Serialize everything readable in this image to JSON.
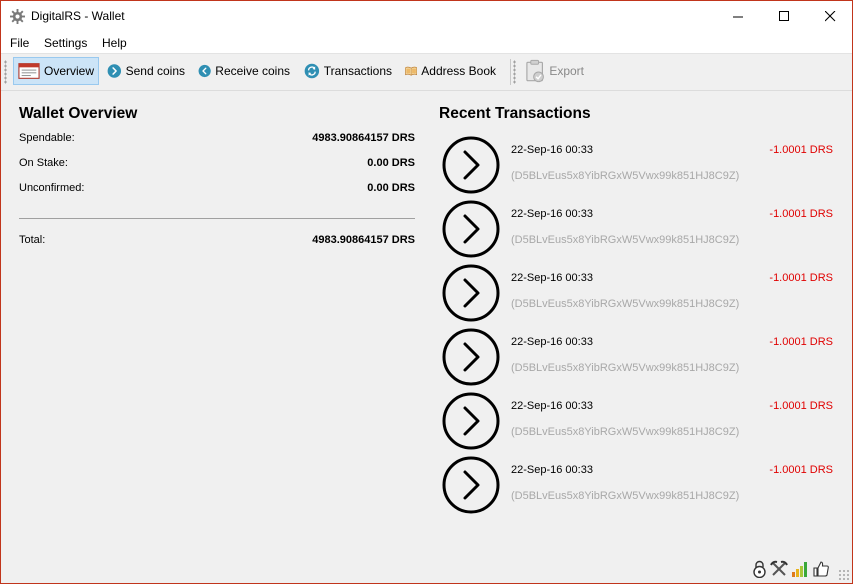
{
  "window": {
    "title": "DigitalRS - Wallet"
  },
  "menu": {
    "items": [
      "File",
      "Settings",
      "Help"
    ]
  },
  "toolbar": {
    "overview": "Overview",
    "send": "Send coins",
    "receive": "Receive coins",
    "transactions": "Transactions",
    "addressbook": "Address Book",
    "export": "Export"
  },
  "overview": {
    "title": "Wallet Overview",
    "rows": [
      {
        "label": "Spendable:",
        "value": "4983.90864157 DRS"
      },
      {
        "label": "On Stake:",
        "value": "0.00 DRS"
      },
      {
        "label": "Unconfirmed:",
        "value": "0.00 DRS"
      }
    ],
    "total": {
      "label": "Total:",
      "value": "4983.90864157 DRS"
    }
  },
  "recent": {
    "title": "Recent Transactions",
    "items": [
      {
        "date": "22-Sep-16 00:33",
        "amount": "-1.0001 DRS",
        "address": "(D5BLvEus5x8YibRGxW5Vwx99k851HJ8C9Z)"
      },
      {
        "date": "22-Sep-16 00:33",
        "amount": "-1.0001 DRS",
        "address": "(D5BLvEus5x8YibRGxW5Vwx99k851HJ8C9Z)"
      },
      {
        "date": "22-Sep-16 00:33",
        "amount": "-1.0001 DRS",
        "address": "(D5BLvEus5x8YibRGxW5Vwx99k851HJ8C9Z)"
      },
      {
        "date": "22-Sep-16 00:33",
        "amount": "-1.0001 DRS",
        "address": "(D5BLvEus5x8YibRGxW5Vwx99k851HJ8C9Z)"
      },
      {
        "date": "22-Sep-16 00:33",
        "amount": "-1.0001 DRS",
        "address": "(D5BLvEus5x8YibRGxW5Vwx99k851HJ8C9Z)"
      },
      {
        "date": "22-Sep-16 00:33",
        "amount": "-1.0001 DRS",
        "address": "(D5BLvEus5x8YibRGxW5Vwx99k851HJ8C9Z)"
      }
    ]
  },
  "status": {
    "icons": [
      "lock-icon",
      "mining-icon",
      "connections-icon",
      "synced-icon"
    ]
  },
  "colors": {
    "accent": "#2f8fb3",
    "negative": "#e00000",
    "window_border": "#c1351b",
    "active_tab": "#cce4f7"
  }
}
